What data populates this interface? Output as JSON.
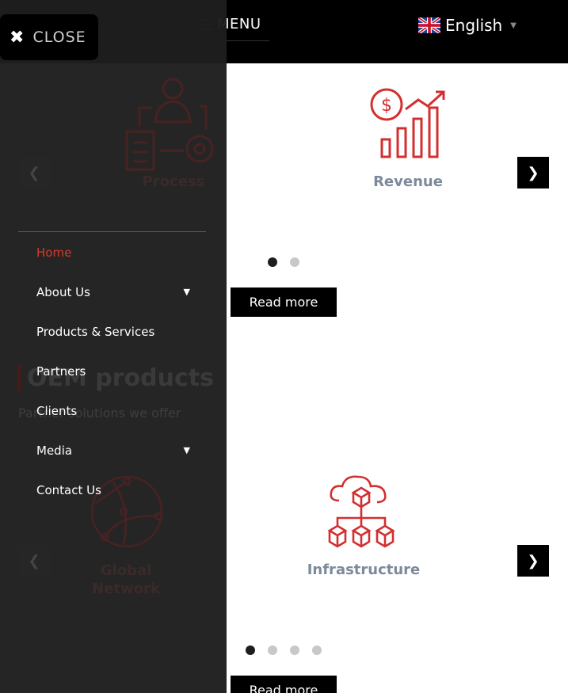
{
  "header": {
    "menu_label": "MENU",
    "language_label": "English"
  },
  "slider1": {
    "visible_slide_title": "Revenue",
    "hidden_slide_title": "Process",
    "prev_arrow": "‹",
    "next_arrow": "›",
    "dots_active_index": 0,
    "dots_count": 2,
    "read_more_label": "Read more"
  },
  "section": {
    "heading": "OEM products",
    "subtitle": "Partner solutions we offer"
  },
  "slider2": {
    "visible_slide_title": "Infrastructure",
    "hidden_slide_title_line1": "Global",
    "hidden_slide_title_line2": "Network",
    "dots_active_index": 0,
    "dots_count": 4,
    "read_more_label": "Read more"
  },
  "drawer": {
    "close_label": "CLOSE",
    "items": [
      {
        "label": "Home",
        "active": true,
        "has_submenu": false
      },
      {
        "label": "About Us",
        "active": false,
        "has_submenu": true
      },
      {
        "label": "Products & Services",
        "active": false,
        "has_submenu": false
      },
      {
        "label": "Partners",
        "active": false,
        "has_submenu": false
      },
      {
        "label": "Clients",
        "active": false,
        "has_submenu": false
      },
      {
        "label": "Media",
        "active": false,
        "has_submenu": true
      },
      {
        "label": "Contact Us",
        "active": false,
        "has_submenu": false
      }
    ]
  },
  "colors": {
    "accent": "#c62828",
    "icon_red": "#d32f2f",
    "title_gray": "#7c8a99"
  }
}
